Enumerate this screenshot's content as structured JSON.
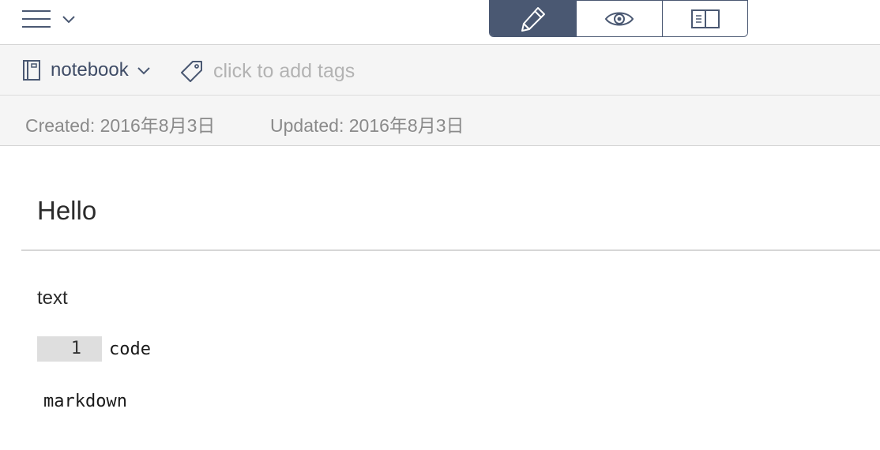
{
  "toolbar": {
    "menu_icon": "hamburger-icon",
    "menu_chevron_icon": "chevron-down-icon",
    "modes": [
      {
        "name": "edit",
        "icon": "pencil-icon",
        "active": true
      },
      {
        "name": "preview",
        "icon": "eye-icon",
        "active": false
      },
      {
        "name": "split",
        "icon": "split-view-icon",
        "active": false
      }
    ],
    "accent_color": "#4a5872"
  },
  "meta": {
    "notebook": "notebook",
    "tags_placeholder": "click to add tags"
  },
  "dates": {
    "created": "Created: 2016年8月3日",
    "updated": "Updated: 2016年8月3日"
  },
  "note": {
    "heading": "Hello",
    "paragraph": "text",
    "code_line_number": "1",
    "code_text": "code",
    "inline_code": "markdown"
  }
}
